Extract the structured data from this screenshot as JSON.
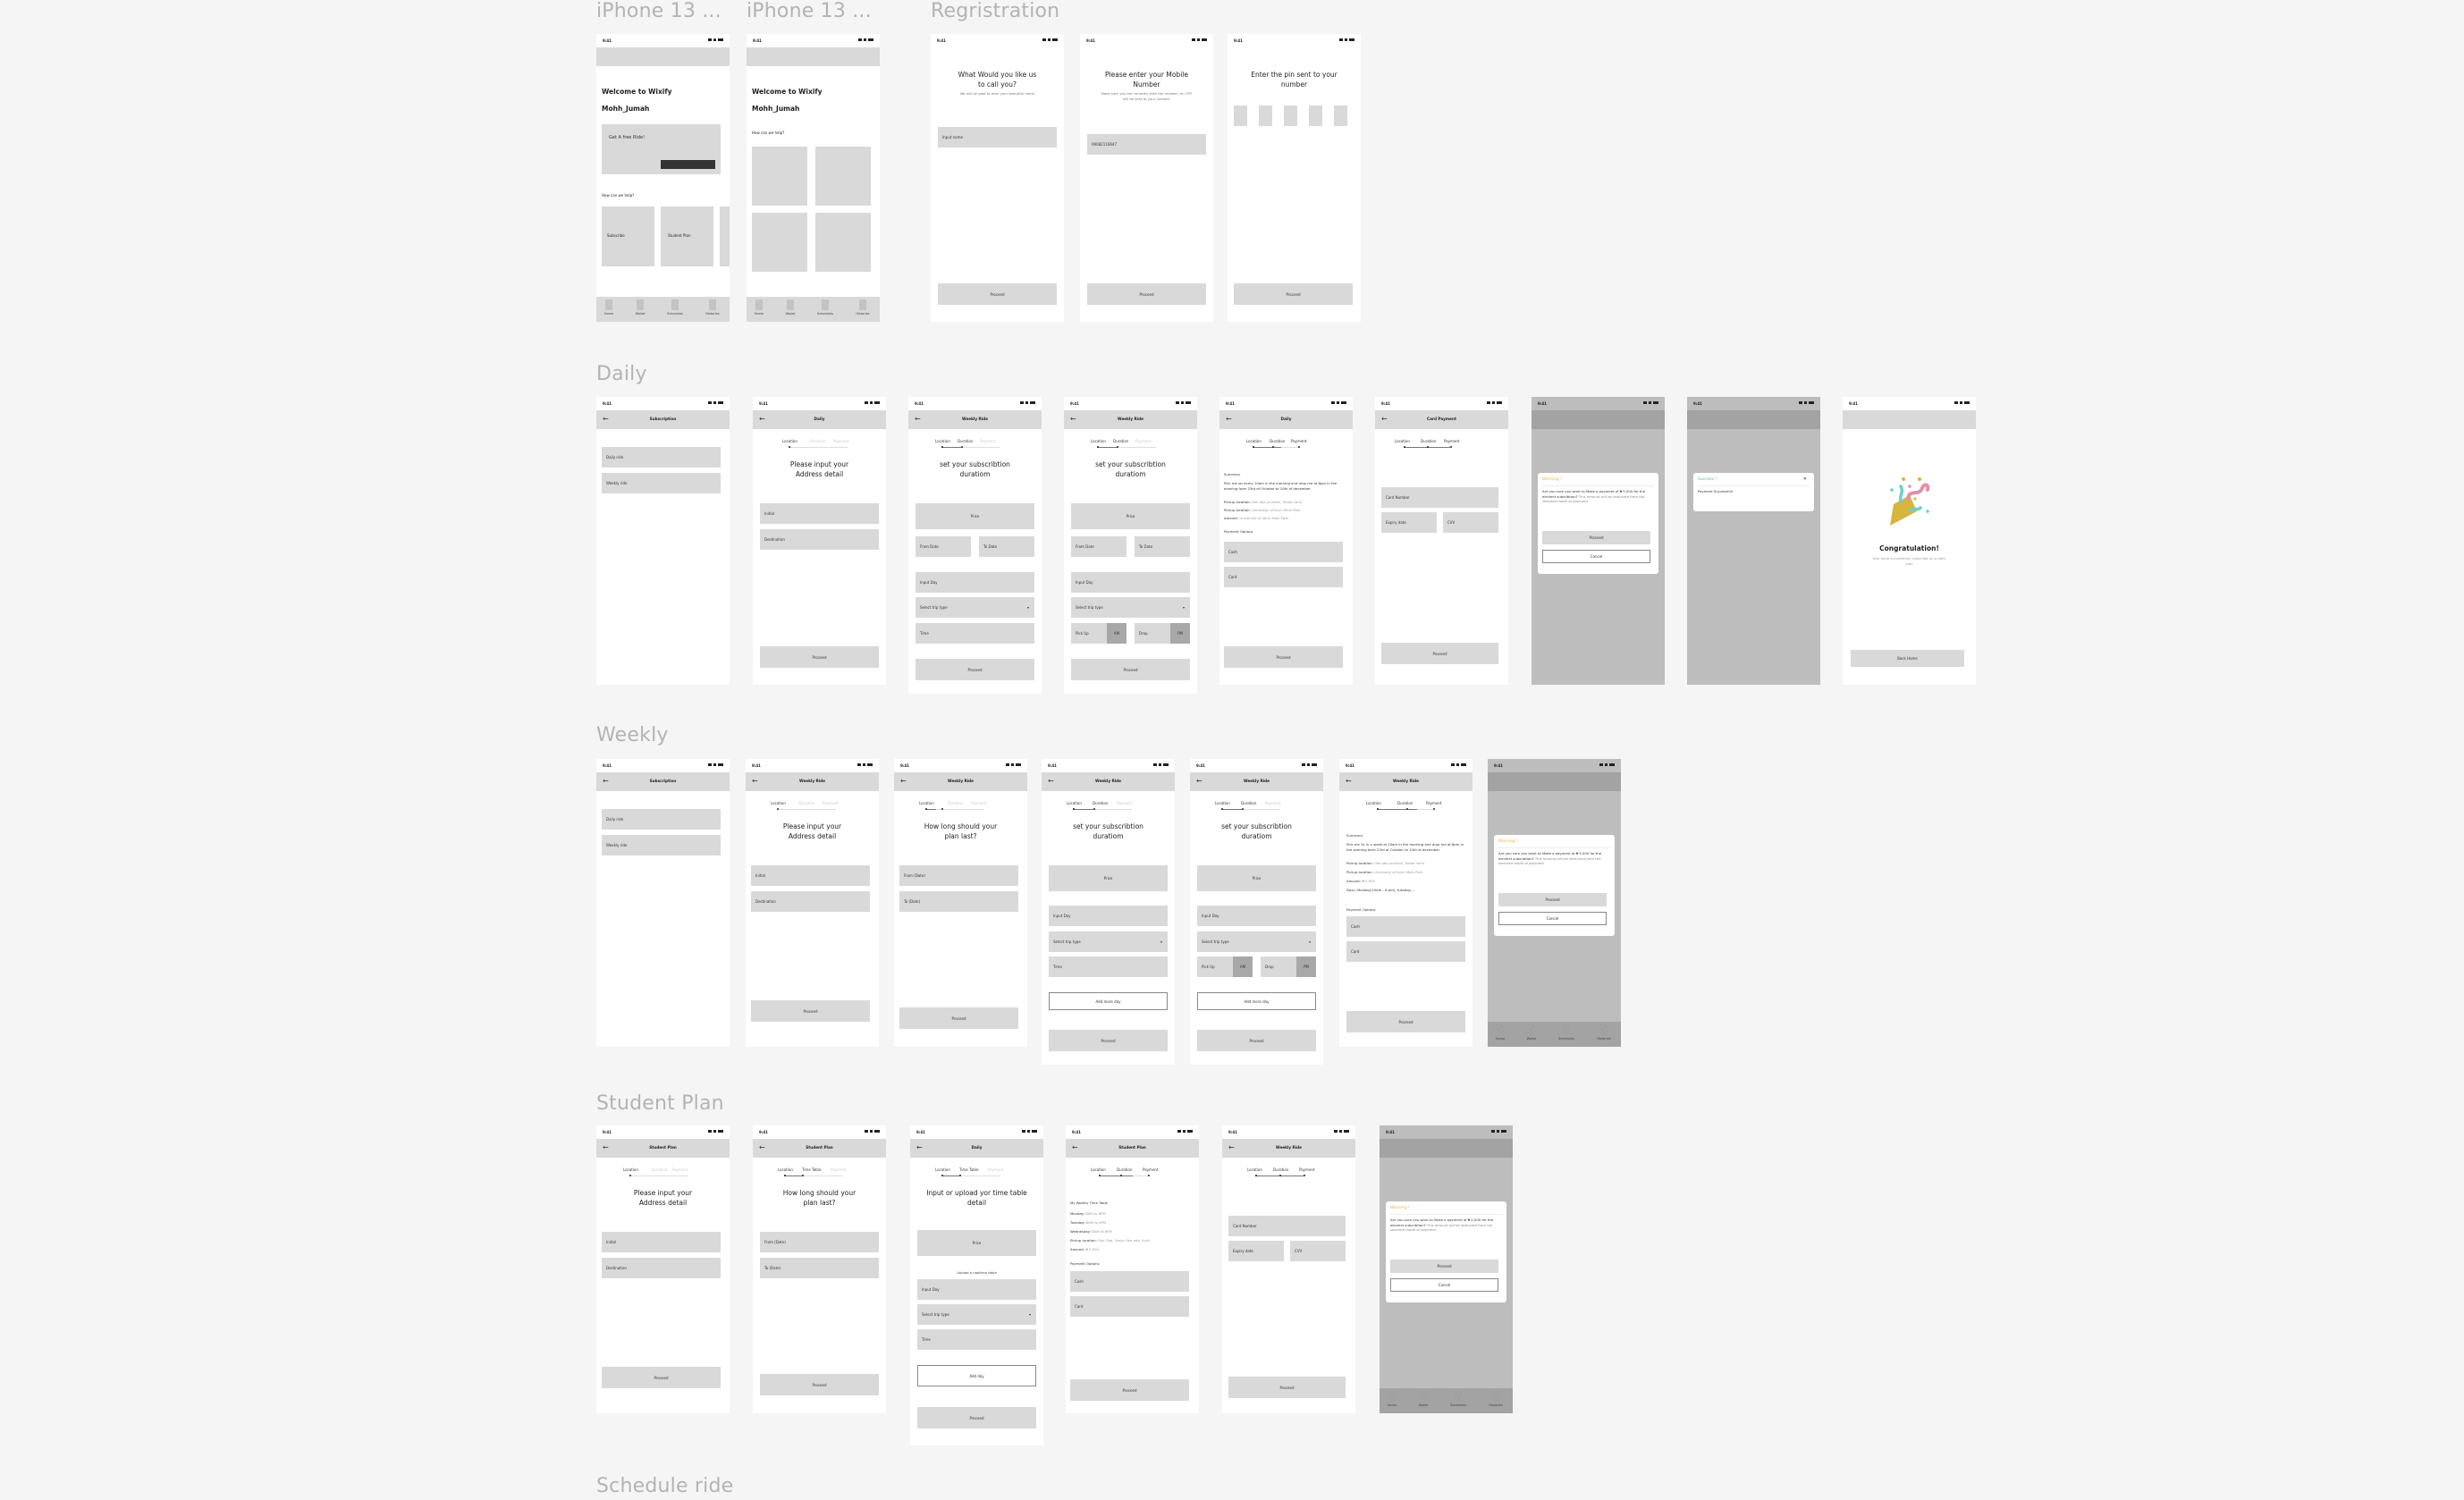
{
  "sections": {
    "iphone1": "iPhone 13 ...",
    "iphone2": "iPhone 13 ...",
    "registration": "Regristration",
    "daily": "Daily",
    "weekly": "Weekly",
    "student": "Student Plan",
    "schedule": "Schedule ride"
  },
  "common": {
    "time": "9:41",
    "back": "←",
    "proceed": "Proceed",
    "cancel": "Cancel",
    "dropdown_arrow": "▾",
    "close": "✕",
    "steps": {
      "location": "Location",
      "duration": "Duration",
      "payment": "Payment",
      "time_table": "Time Table"
    },
    "nav": [
      "Home",
      "Wallet",
      "Schedules",
      "Histories"
    ]
  },
  "home1": {
    "welcome": "Welcome to Wixify",
    "user": "Mohh_Jumah",
    "promo": "Get A free Ride!",
    "help": "How can we help?",
    "cards": [
      "Subscribe",
      "Student Plan"
    ]
  },
  "home2": {
    "welcome": "Welcome to Wixify",
    "user": "Mohh_Jumah",
    "help": "How can we help?"
  },
  "reg_name": {
    "title": "What Would you like us to call you?",
    "subtitle": "We will be glad to hear your beautiful name",
    "input_placeholder": "Input name"
  },
  "reg_phone": {
    "title": "Please enter your Mobile Number",
    "subtitle": "Make sure you are currently with the number, an OTP will be sent to your number.",
    "input_value": "09082116647"
  },
  "reg_pin": {
    "title": "Enter the pin sent to your number"
  },
  "subscription": {
    "title": "Subscription",
    "options": [
      "Daily ride",
      "Weekly ride"
    ]
  },
  "address": {
    "title": "Please input your Address detail",
    "initial": "Initial",
    "destination": "Destination"
  },
  "duration": {
    "title": "set your subscribtion duratiom",
    "price": "Price",
    "from_date": "From Date",
    "to_date": "To Date",
    "input_day": "Input Day",
    "trip_type": "Select trip type",
    "time": "Time",
    "pick_up": "Pick Up",
    "am": "AM",
    "drop": "Drop",
    "pm": "PM",
    "add_more_day": "Add more day"
  },
  "plan_length": {
    "title": "How long should your plan last?",
    "from_date": "From (Date)",
    "to_date": "To (Date)"
  },
  "daily_summary": {
    "title": "Daily",
    "summary_label": "Summary",
    "summary": "Pick me up every 10am in the morning and drop me at 6pm in the evening form 23rd of October to 10th of december.",
    "pickup_label": "Pickup location:",
    "pickup_value": "Oko oba junction, Tanke Ilorin.",
    "dropoff_label": "Pickup location:",
    "dropoff_value": "University of Ilorin Main Park.",
    "amount_label": "Amount:",
    "amount_value": "University of Ilorin Main Park.",
    "payment_options": "Payment Options",
    "cash": "Cash",
    "card": "Card"
  },
  "card_payment": {
    "title": "Card Payment",
    "card_number": "Card Number",
    "expiry": "Expiry date",
    "cvv": "CVV"
  },
  "warning": {
    "title": "Warning !",
    "body_bold": "Are you sure you want to Make a payment of ₦ 5,000 for the electect subcribtion?",
    "body_muted": "This amount will be deducted from the selected mode of payment"
  },
  "success": {
    "title": "Success !",
    "body": "Payment Successful!"
  },
  "congrats": {
    "title": "Congratulation!",
    "subtitle": "Your have successfully subscribe on a daily plan",
    "button": "Back Home",
    "colors": {
      "popper": "#d8b43a",
      "pink": "#e58fa8",
      "teal": "#6fcfcc"
    }
  },
  "weekly": {
    "title": "Weekly Ride"
  },
  "weekly_summary": {
    "summary": "Pick me 3x in a week at 10am in the morning and drop me at 6pm in the evening form 23rd of October to 10th of december.",
    "amount_value": "₦ 5,000",
    "days_label": "Days:",
    "days_value": "Monday(10am - 6 pm), tuesday...."
  },
  "student": {
    "title": "Student Plan",
    "daily_title": "Daily",
    "timetable_title": "Input or upload yor time table detail",
    "upload": "Upload a naptime table",
    "add_day": "Add day",
    "my_timetable": "My Weekly Time Table",
    "monday_label": "Monday:",
    "monday_value": "8AM to 6PM",
    "tuesday_label": "Tuesday:",
    "tuesday_value": "8AM to 6PM",
    "wednesday_label": "Wednesday:",
    "wednesday_value": "8AM to 6PM",
    "pickup_label": "Pickup location:",
    "pickup_value": "Oko Oba, Tanke Oke-odo, Ilorin",
    "amount_label": "Amount:",
    "amount_value": "₦ 5,000"
  }
}
